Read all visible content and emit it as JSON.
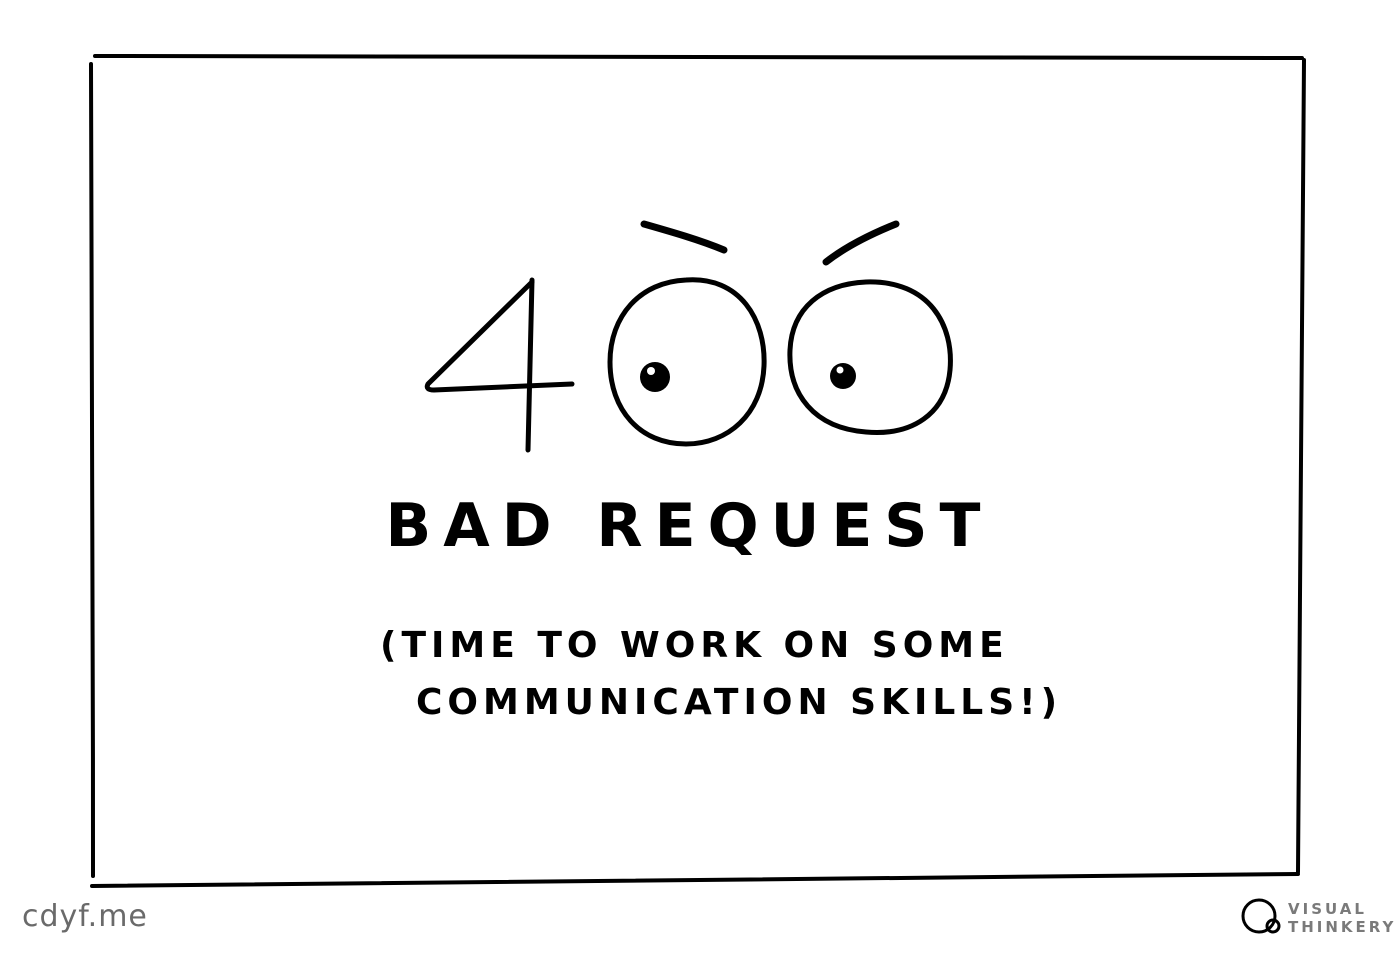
{
  "colors": {
    "ink": "#000000",
    "background": "#ffffff",
    "footer_ink": "#6a6a6a"
  },
  "illustration": {
    "code_digit": "4",
    "eye_left_icon": "eye-icon",
    "eye_right_icon": "eye-icon",
    "brow_left_icon": "eyebrow-icon",
    "brow_right_icon": "eyebrow-icon"
  },
  "title": "BAD REQUEST",
  "subtitle": {
    "line1": "(TIME TO WORK ON SOME",
    "line2": "COMMUNICATION SKILLS!)"
  },
  "footer": {
    "site": "cdyf.me",
    "brand_line1": "VISUAL",
    "brand_line2": "THINKERY",
    "brand_icon": "magnifier-logo-icon"
  }
}
